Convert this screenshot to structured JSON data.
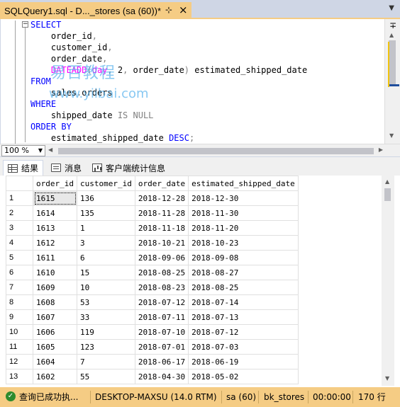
{
  "tab": {
    "title": "SQLQuery1.sql - D..._stores (sa (60))*",
    "pin_icon": "pin-icon",
    "close_icon": "close-icon"
  },
  "editor": {
    "lines": [
      [
        {
          "t": "SELECT",
          "c": "kw"
        }
      ],
      [
        {
          "t": "    order_id",
          "c": "blk"
        },
        {
          "t": ",",
          "c": "gray"
        }
      ],
      [
        {
          "t": "    customer_id",
          "c": "blk"
        },
        {
          "t": ",",
          "c": "gray"
        }
      ],
      [
        {
          "t": "    order_date",
          "c": "blk"
        },
        {
          "t": ",",
          "c": "gray"
        }
      ],
      [
        {
          "t": "    ",
          "c": "blk"
        },
        {
          "t": "DATEADD",
          "c": "fn"
        },
        {
          "t": "(",
          "c": "gray"
        },
        {
          "t": "day",
          "c": "fn"
        },
        {
          "t": ", ",
          "c": "gray"
        },
        {
          "t": "2",
          "c": "blk"
        },
        {
          "t": ", ",
          "c": "gray"
        },
        {
          "t": "order_date",
          "c": "blk"
        },
        {
          "t": ")",
          "c": "gray"
        },
        {
          "t": " estimated_shipped_date",
          "c": "blk"
        }
      ],
      [
        {
          "t": "FROM",
          "c": "kw"
        }
      ],
      [
        {
          "t": "    sales",
          "c": "blk"
        },
        {
          "t": ".",
          "c": "gray"
        },
        {
          "t": "orders",
          "c": "blk"
        }
      ],
      [
        {
          "t": "WHERE",
          "c": "kw"
        }
      ],
      [
        {
          "t": "    shipped_date ",
          "c": "blk"
        },
        {
          "t": "IS NULL",
          "c": "gray"
        }
      ],
      [
        {
          "t": "ORDER BY",
          "c": "kw"
        }
      ],
      [
        {
          "t": "    estimated_shipped_date ",
          "c": "blk"
        },
        {
          "t": "DESC",
          "c": "kw"
        },
        {
          "t": ";",
          "c": "gray"
        }
      ]
    ],
    "watermark_cn": "易百教程",
    "watermark_url": "www.yiibai.com"
  },
  "zoom": {
    "value": "100 %"
  },
  "results_tabs": [
    {
      "label": "结果",
      "icon": "grid-icon"
    },
    {
      "label": "消息",
      "icon": "message-icon"
    },
    {
      "label": "客户端统计信息",
      "icon": "statistics-icon"
    }
  ],
  "grid": {
    "columns": [
      "order_id",
      "customer_id",
      "order_date",
      "estimated_shipped_date"
    ],
    "rows": [
      [
        "1",
        "1615",
        "136",
        "2018-12-28",
        "2018-12-30"
      ],
      [
        "2",
        "1614",
        "135",
        "2018-11-28",
        "2018-11-30"
      ],
      [
        "3",
        "1613",
        "1",
        "2018-11-18",
        "2018-11-20"
      ],
      [
        "4",
        "1612",
        "3",
        "2018-10-21",
        "2018-10-23"
      ],
      [
        "5",
        "1611",
        "6",
        "2018-09-06",
        "2018-09-08"
      ],
      [
        "6",
        "1610",
        "15",
        "2018-08-25",
        "2018-08-27"
      ],
      [
        "7",
        "1609",
        "10",
        "2018-08-23",
        "2018-08-25"
      ],
      [
        "8",
        "1608",
        "53",
        "2018-07-12",
        "2018-07-14"
      ],
      [
        "9",
        "1607",
        "33",
        "2018-07-11",
        "2018-07-13"
      ],
      [
        "10",
        "1606",
        "119",
        "2018-07-10",
        "2018-07-12"
      ],
      [
        "11",
        "1605",
        "123",
        "2018-07-01",
        "2018-07-03"
      ],
      [
        "12",
        "1604",
        "7",
        "2018-06-17",
        "2018-06-19"
      ],
      [
        "13",
        "1602",
        "55",
        "2018-04-30",
        "2018-05-02"
      ]
    ]
  },
  "status": {
    "message": "查询已成功执...",
    "server": "DESKTOP-MAXSU (14.0 RTM)",
    "user": "sa (60)",
    "database": "bk_stores",
    "elapsed": "00:00:00",
    "rows": "170 行"
  }
}
